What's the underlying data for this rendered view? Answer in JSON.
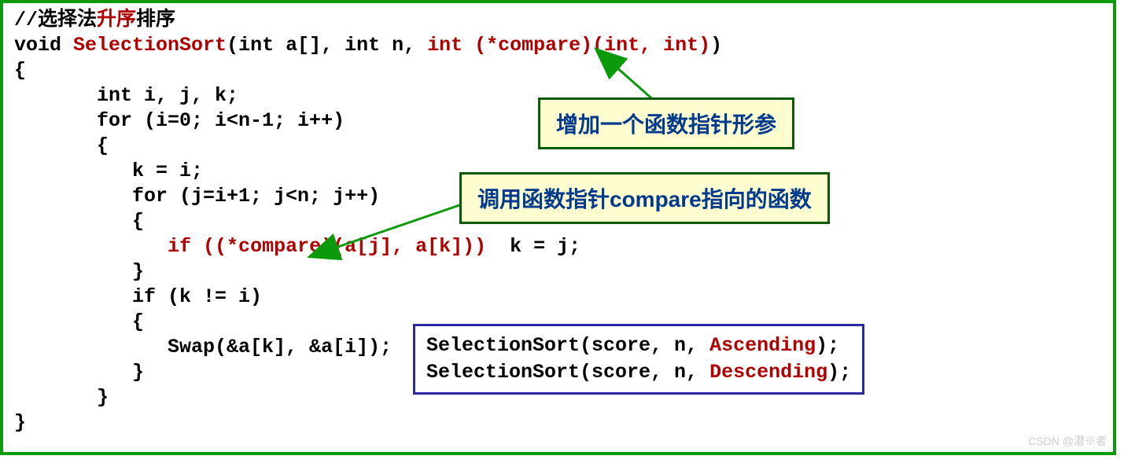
{
  "comment": {
    "prefix": "//选择法",
    "highlight": "升序",
    "suffix": "排序"
  },
  "code": {
    "line1_a": "void ",
    "line1_fn": "SelectionSort",
    "line1_b": "(int a[], int n, ",
    "line1_fp": "int (*compare)(int, int)",
    "line1_c": ")",
    "line2": "{",
    "line3": "       int i, j, k;",
    "line4": "       for (i=0; i<n-1; i++)",
    "line5": "       {",
    "line6": "          k = i;",
    "line7": "          for (j=i+1; j<n; j++)",
    "line8": "          {",
    "line9_a": "             ",
    "line9_if": "if ((*compare)(a[j], a[k]))",
    "line9_b": "  k = j;",
    "line10": "          }",
    "line11": "          if (k != i)",
    "line12": "          {",
    "line13": "             Swap(&a[k], &a[i]);",
    "line14": "          }",
    "line15": "       }",
    "line16": "}"
  },
  "callout1": "增加一个函数指针形参",
  "callout2": "调用函数指针compare指向的函数",
  "example": {
    "line1_a": "SelectionSort(score, n, ",
    "line1_fn": "Ascending",
    "line1_b": ");",
    "line2_a": "SelectionSort(score, n, ",
    "line2_fn": "Descending",
    "line2_b": ");"
  },
  "watermark": "CSDN @潜※者"
}
